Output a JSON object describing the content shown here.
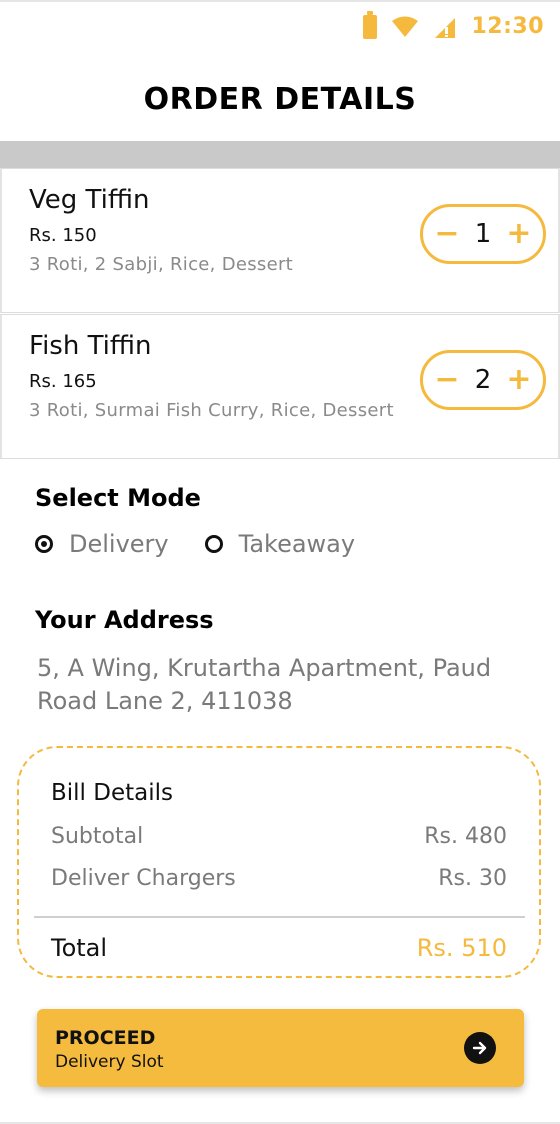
{
  "status_bar": {
    "time": "12:30",
    "icons": [
      "battery-icon",
      "wifi-icon",
      "cellular-signal-icon"
    ],
    "accent_color": "#F4B93D"
  },
  "header": {
    "title": "ORDER DETAILS"
  },
  "items": [
    {
      "name": "Veg Tiffin",
      "price": "Rs. 150",
      "description": "3 Roti, 2 Sabji, Rice, Dessert",
      "quantity": "1",
      "decrement": "−",
      "increment": "+"
    },
    {
      "name": "Fish Tiffin",
      "price": "Rs. 165",
      "description": "3 Roti, Surmai Fish Curry, Rice, Dessert",
      "quantity": "2",
      "decrement": "−",
      "increment": "+"
    }
  ],
  "mode": {
    "title": "Select Mode",
    "options": [
      {
        "label": "Delivery",
        "selected": true
      },
      {
        "label": "Takeaway",
        "selected": false
      }
    ]
  },
  "address": {
    "title": "Your Address",
    "value": "5, A Wing, Krutartha Apartment, Paud Road Lane 2, 411038"
  },
  "bill": {
    "title": "Bill Details",
    "rows": [
      {
        "label": "Subtotal",
        "value": "Rs. 480"
      },
      {
        "label": "Deliver Chargers",
        "value": "Rs. 30"
      }
    ],
    "total_label": "Total",
    "total_value": "Rs. 510"
  },
  "proceed": {
    "label": "PROCEED",
    "sub_label": "Delivery Slot",
    "icon": "arrow-right-circle-icon"
  },
  "colors": {
    "accent": "#F4B93D",
    "muted_text": "#7A7A7A",
    "band": "#C9C9C9"
  }
}
